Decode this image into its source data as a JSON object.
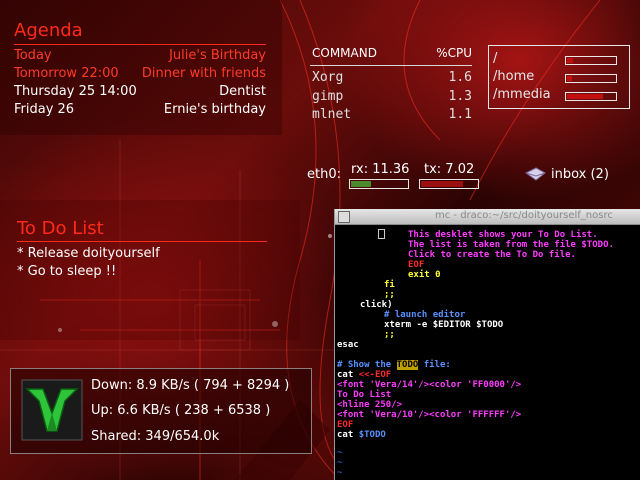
{
  "agenda": {
    "title": "Agenda",
    "rows": [
      {
        "when": "Today",
        "what": "Julie's Birthday",
        "style": "red"
      },
      {
        "when": "Tomorrow 22:00",
        "what": "Dinner with friends",
        "style": "red"
      },
      {
        "when": "Thursday 25 14:00",
        "what": "Dentist",
        "style": "white"
      },
      {
        "when": "Friday 26",
        "what": "Ernie's birthday",
        "style": "white"
      }
    ]
  },
  "top": {
    "col_command": "COMMAND",
    "col_cpu": "%CPU",
    "procs": [
      {
        "name": "Xorg",
        "cpu": "1.6"
      },
      {
        "name": "gimp",
        "cpu": "1.3"
      },
      {
        "name": "mlnet",
        "cpu": "1.1"
      }
    ]
  },
  "disks": [
    {
      "label": "/",
      "fill": 0.12
    },
    {
      "label": "/home",
      "fill": 0.1
    },
    {
      "label": "/mmedia",
      "fill": 0.75
    }
  ],
  "net": {
    "iface": "eth0:",
    "rx_label": "rx: 11.36",
    "tx_label": "tx: 7.02",
    "rx_fill": 0.35,
    "tx_fill": 0.75,
    "rx_color": "#4a8a2a",
    "tx_color": "#9a1010"
  },
  "mail": {
    "label": "inbox (2)",
    "icon": "envelope-icon"
  },
  "todo": {
    "title": "To Do List",
    "items": [
      "* Release doityourself",
      "* Go to sleep !!"
    ]
  },
  "p2p": {
    "down": "Down: 8.9 KB/s ( 794 + 8294 )",
    "up": "Up: 6.6 KB/s ( 238 + 6538 )",
    "shared": "Shared: 349/654.0k",
    "logo": "mldonkey-logo-icon"
  },
  "terminal": {
    "title": "mc - draco:~/src/doityourself_nosrc",
    "lines": {
      "l1": "This desklet shows your To Do List.",
      "l2": "The list is taken from the file $TODO.",
      "l3": "Click to create the To Do file.",
      "l4": "EOF",
      "l5": "exit 0",
      "l6": "fi",
      "l7": ";;",
      "l8": "click)",
      "l9": "# launch editor",
      "l10": "xterm -e $EDITOR $TODO",
      "l11": ";;",
      "l12": "esac",
      "l13a": "# Show the ",
      "l13b": "TODO",
      "l13c": " file:",
      "l14a": "cat ",
      "l14b": "<<-EOF",
      "l15": "<font 'Vera/14'/><color 'FF0000'/>",
      "l16": "To Do List",
      "l17": "<hline 250/>",
      "l18": "<font 'Vera/10'/><color 'FFFFFF'/>",
      "l19": "EOF",
      "l20a": "cat ",
      "l20b": "$TODO",
      "tilde": "~"
    }
  },
  "colors": {
    "accent_red": "#ff2a1a",
    "terminal_bg": "#000000"
  }
}
